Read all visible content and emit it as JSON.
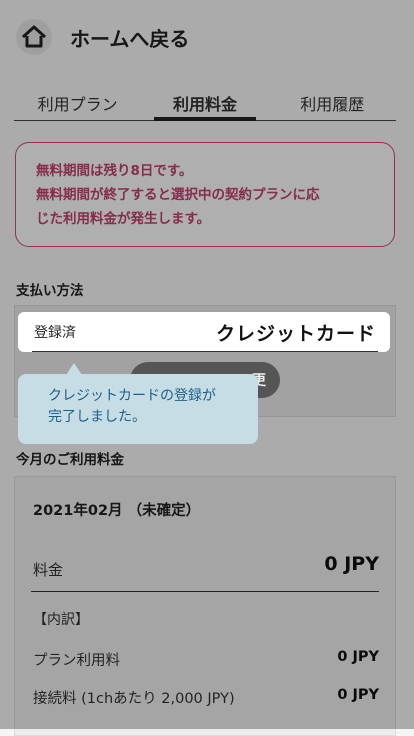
{
  "header": {
    "title": "ホームへ戻る",
    "home_icon": "home-icon"
  },
  "tabs": [
    {
      "label": "利用プラン",
      "active": false
    },
    {
      "label": "利用料金",
      "active": true
    },
    {
      "label": "利用履歴",
      "active": false
    }
  ],
  "notice": {
    "line1": "無料期間は残り8日です。",
    "line2": "無料期間が終了すると選択中の契約プランに応",
    "line3": "じた利用料金が発生します。"
  },
  "payment": {
    "section_title": "支払い方法",
    "status_label": "登録済",
    "method": "クレジットカード",
    "change_button_visible": "更",
    "tooltip_line1": "クレジットカードの登録が",
    "tooltip_line2": "完了しました。"
  },
  "fees": {
    "section_title": "今月のご利用料金",
    "period": "2021年02月 （未確定）",
    "total_label": "料金",
    "total_value": "0 JPY",
    "breakdown_label": "【内訳】",
    "rows": [
      {
        "label": "プラン利用料",
        "value": "0 JPY"
      },
      {
        "label": "接続料 (1chあたり 2,000 JPY)",
        "value": "0 JPY"
      }
    ]
  },
  "colors": {
    "notice_border": "#c94a7d",
    "notice_text": "#c0406f",
    "tooltip_bg": "#c6dde6",
    "tooltip_text": "#1c5f8a"
  }
}
